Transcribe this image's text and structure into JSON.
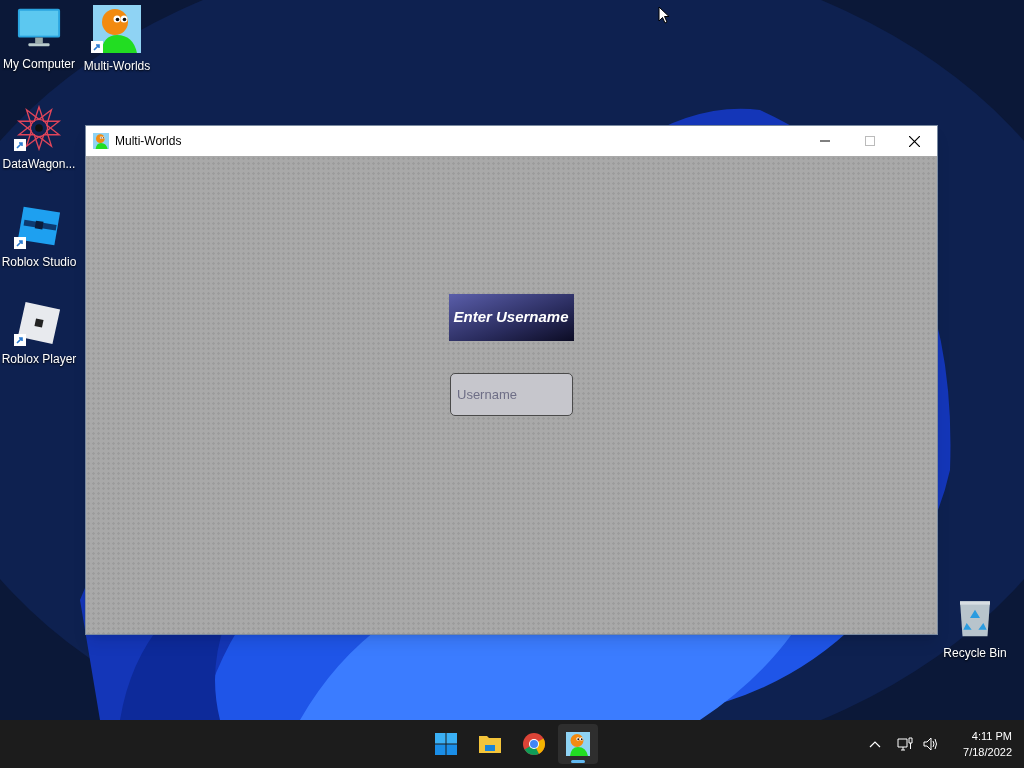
{
  "desktop_icons": [
    {
      "kind": "computer",
      "label": "My Computer",
      "shortcut": false
    },
    {
      "kind": "app",
      "label": "Multi-Worlds",
      "shortcut": true
    },
    {
      "kind": "star",
      "label": "DataWagon...",
      "shortcut": true
    },
    {
      "kind": "studio",
      "label": "Roblox Studio",
      "shortcut": true
    },
    {
      "kind": "player",
      "label": "Roblox Player",
      "shortcut": true
    },
    {
      "kind": "bin",
      "label": "Recycle Bin",
      "shortcut": false
    }
  ],
  "window": {
    "title": "Multi-Worlds",
    "heading": "Enter Username",
    "username_field": {
      "placeholder": "Username"
    }
  },
  "taskbar": {
    "apps": [
      {
        "kind": "start",
        "selected": false
      },
      {
        "kind": "explorer",
        "selected": false
      },
      {
        "kind": "chrome",
        "selected": false
      },
      {
        "kind": "app",
        "selected": true
      }
    ],
    "clock": {
      "time": "4:11 PM",
      "date": "7/18/2022"
    }
  }
}
